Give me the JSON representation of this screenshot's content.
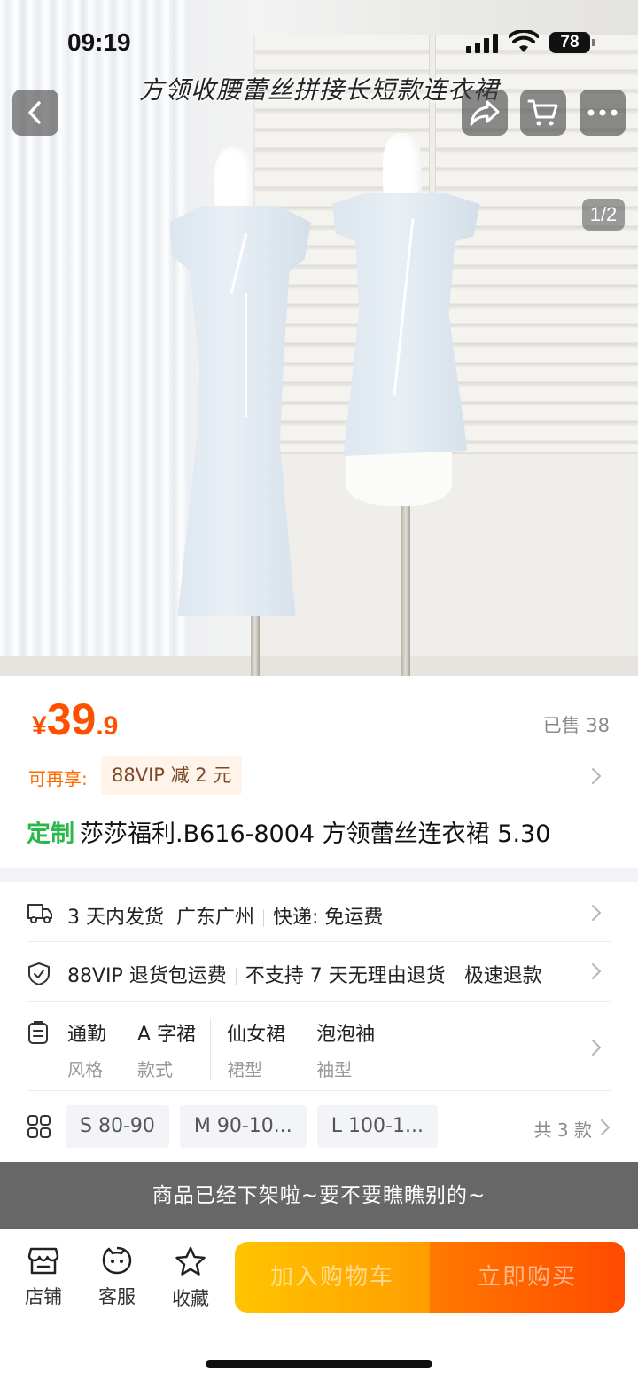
{
  "status_bar": {
    "time": "09:19",
    "battery": "78"
  },
  "header": {
    "title_overlay": "方领收腰蕾丝拼接长短款连衣裙",
    "image_counter": "1/2"
  },
  "price": {
    "currency": "¥",
    "integer": "39",
    "decimal": ".9",
    "sold": "已售 38"
  },
  "vip": {
    "label": "可再享:",
    "badge": "88VIP 减 2 元"
  },
  "product": {
    "tag": "定制",
    "title": "莎莎福利.B616-8004 方领蕾丝连衣裙 5.30"
  },
  "shipping": {
    "delivery": "3 天内发货",
    "origin": "广东广州",
    "express": "快递: 免运费"
  },
  "service": {
    "item1": "88VIP 退货包运费",
    "item2": "不支持 7 天无理由退货",
    "item3": "极速退款"
  },
  "attributes": [
    {
      "value": "通勤",
      "key": "风格"
    },
    {
      "value": "A 字裙",
      "key": "款式"
    },
    {
      "value": "仙女裙",
      "key": "裙型"
    },
    {
      "value": "泡泡袖",
      "key": "袖型"
    }
  ],
  "skus": {
    "options": [
      "S 80-90",
      "M 90-10...",
      "L 100-1..."
    ],
    "count": "共 3 款"
  },
  "offline_notice": "商品已经下架啦~要不要瞧瞧别的~",
  "bottom_bar": {
    "store": "店铺",
    "service": "客服",
    "favorite": "收藏",
    "add_to_cart": "加入购物车",
    "buy_now": "立即购买"
  },
  "colors": {
    "price": "#ff5000",
    "custom_tag": "#2db84d",
    "cart_button": "#ffb300",
    "buy_button": "#ff5a00",
    "banner": "#676767"
  }
}
